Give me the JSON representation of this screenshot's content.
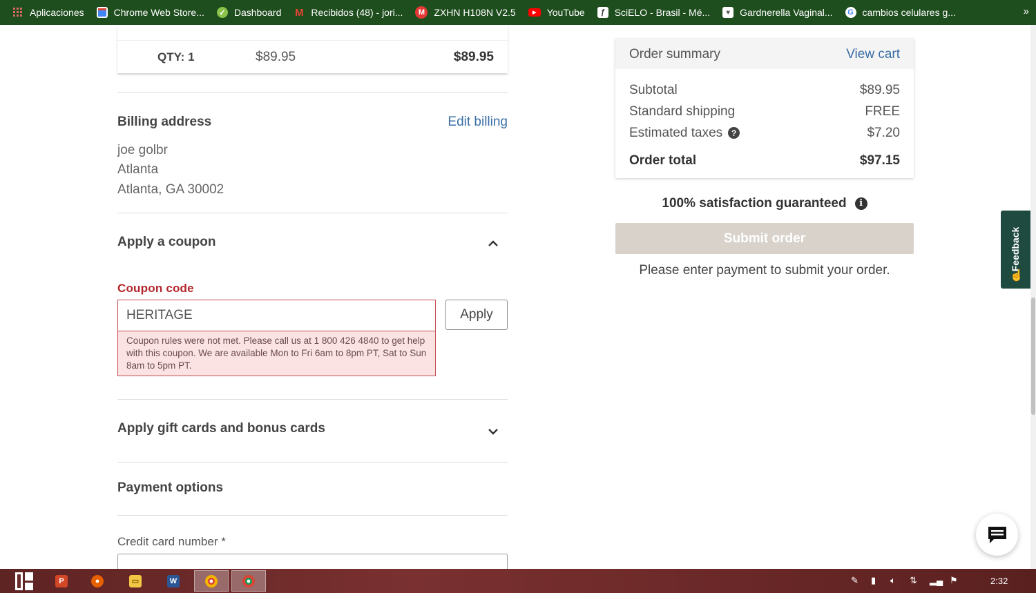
{
  "bookmarks": [
    {
      "label": "Aplicaciones",
      "icon": "apps-grid-icon"
    },
    {
      "label": "Chrome Web Store...",
      "icon": "chrome-web-store-icon"
    },
    {
      "label": "Dashboard",
      "icon": "dashboard-check-icon"
    },
    {
      "label": "Recibidos (48) - jori...",
      "icon": "gmail-icon"
    },
    {
      "label": "ZXHN H108N V2.5",
      "icon": "m-circle-icon"
    },
    {
      "label": "YouTube",
      "icon": "youtube-icon"
    },
    {
      "label": "SciELO - Brasil - Mé...",
      "icon": "scielo-icon"
    },
    {
      "label": "Gardnerella Vaginal...",
      "icon": "bookmark-page-icon"
    },
    {
      "label": "cambios celulares g...",
      "icon": "google-icon"
    }
  ],
  "item": {
    "qty": "QTY: 1",
    "unit_price": "$89.95",
    "line_total": "$89.95"
  },
  "billing": {
    "title": "Billing address",
    "edit_label": "Edit billing",
    "name": "joe golbr",
    "line1": "Atlanta",
    "line2": "Atlanta, GA 30002"
  },
  "coupon": {
    "title": "Apply a coupon",
    "label": "Coupon code",
    "value": "HERITAGE",
    "apply_label": "Apply",
    "error": "Coupon rules were not met. Please call us at 1 800 426 4840 to get help with this coupon. We are available Mon to Fri 6am to 8pm PT, Sat to Sun 8am to 5pm PT."
  },
  "gift": {
    "title": "Apply gift cards and bonus cards"
  },
  "payment": {
    "title": "Payment options",
    "cc_label": "Credit card number *"
  },
  "summary": {
    "title": "Order summary",
    "view_cart": "View cart",
    "subtotal_label": "Subtotal",
    "subtotal": "$89.95",
    "shipping_label": "Standard shipping",
    "shipping": "FREE",
    "taxes_label": "Estimated taxes",
    "taxes": "$7.20",
    "total_label": "Order total",
    "total": "$97.15"
  },
  "guarantee": "100% satisfaction guaranteed",
  "submit_label": "Submit order",
  "pay_note": "Please enter payment to submit your order.",
  "feedback_label": "Feedback",
  "clock": "2:32",
  "colors": {
    "bookmark_bar": "#1e4d1e",
    "link": "#3a6ea5",
    "error": "#b3262d",
    "feedback": "#1f4a3f",
    "submit_disabled": "#d8d2ca"
  }
}
